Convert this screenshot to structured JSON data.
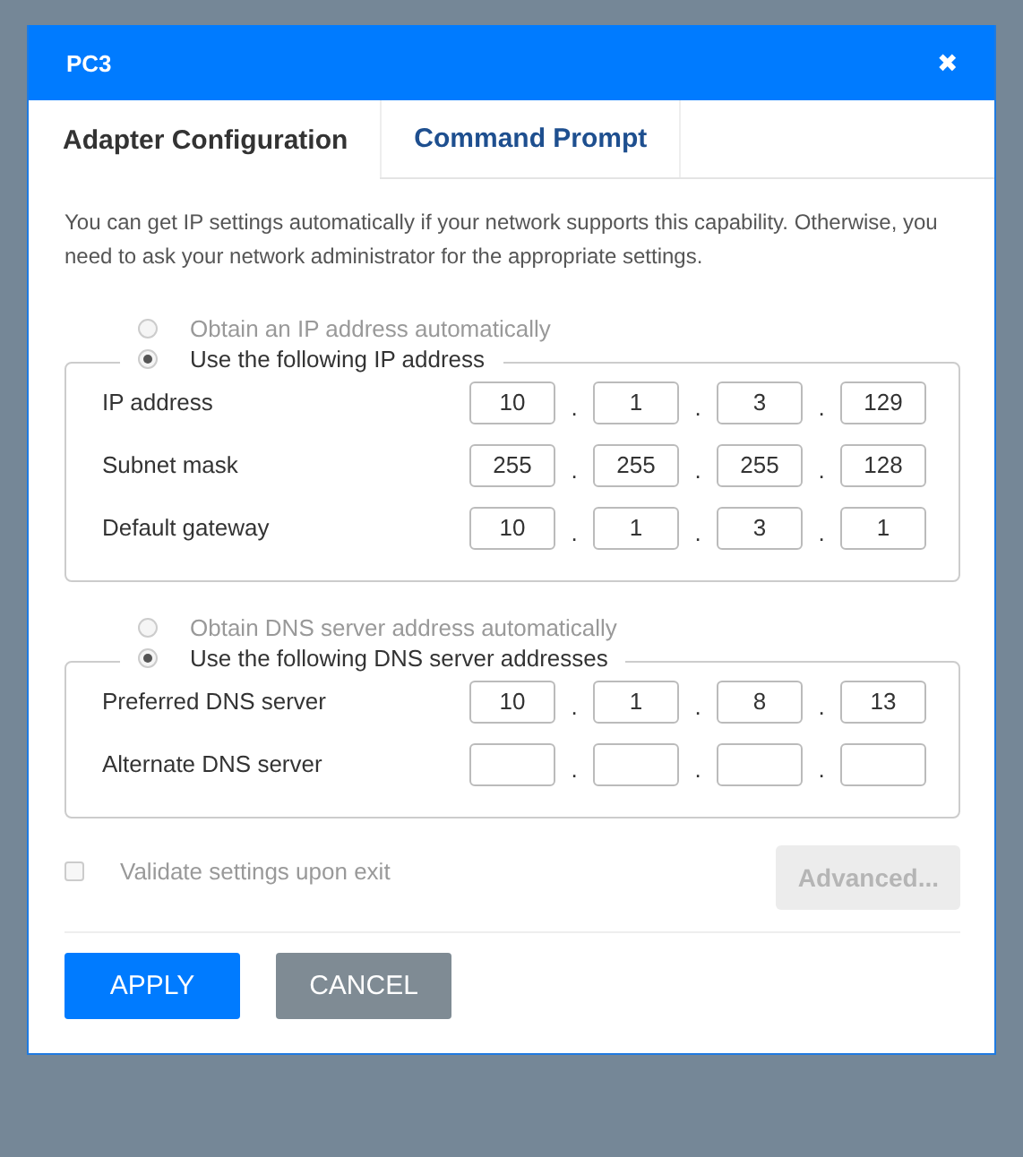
{
  "window": {
    "title": "PC3",
    "close": "✖"
  },
  "tabs": [
    {
      "label": "Adapter Configuration",
      "selected": true
    },
    {
      "label": "Command Prompt",
      "selected": false
    }
  ],
  "intro": "You can get IP settings automatically if your network supports this capability. Otherwise, you need to ask your network administrator for the appropriate settings.",
  "sections": [
    {
      "auto_option": {
        "label": "Obtain an IP address automatically",
        "selected": false,
        "disabled": true
      },
      "manual_option": {
        "label": "Use the following IP address",
        "selected": true,
        "disabled": false
      },
      "rows": [
        {
          "label": "IP address",
          "octets": [
            "10",
            "1",
            "3",
            "129"
          ],
          "separators": [
            ".",
            ".",
            "."
          ]
        },
        {
          "label": "Subnet mask",
          "octets": [
            "255",
            "255",
            "255",
            "128"
          ],
          "separators": [
            ".",
            ".",
            "."
          ]
        },
        {
          "label": "Default gateway",
          "octets": [
            "10",
            "1",
            "3",
            "1"
          ],
          "separators": [
            ".",
            ".",
            "."
          ]
        }
      ]
    },
    {
      "auto_option": {
        "label": "Obtain DNS server address automatically",
        "selected": false,
        "disabled": true
      },
      "manual_option": {
        "label": "Use the following DNS server addresses",
        "selected": true,
        "disabled": false
      },
      "rows": [
        {
          "label": "Preferred DNS server",
          "octets": [
            "10",
            "1",
            "8",
            "13"
          ],
          "separators": [
            ".",
            ".",
            "."
          ]
        },
        {
          "label": "Alternate DNS server",
          "separators": [
            ".",
            ".",
            "."
          ]
        }
      ]
    }
  ],
  "validate": {
    "label": "Validate settings upon exit",
    "checked": false,
    "disabled": true
  },
  "advanced_button": {
    "label": "Advanced...",
    "disabled": true
  },
  "buttons": [
    {
      "label": "APPLY",
      "kind": "primary"
    },
    {
      "label": "CANCEL",
      "kind": "secondary"
    }
  ]
}
